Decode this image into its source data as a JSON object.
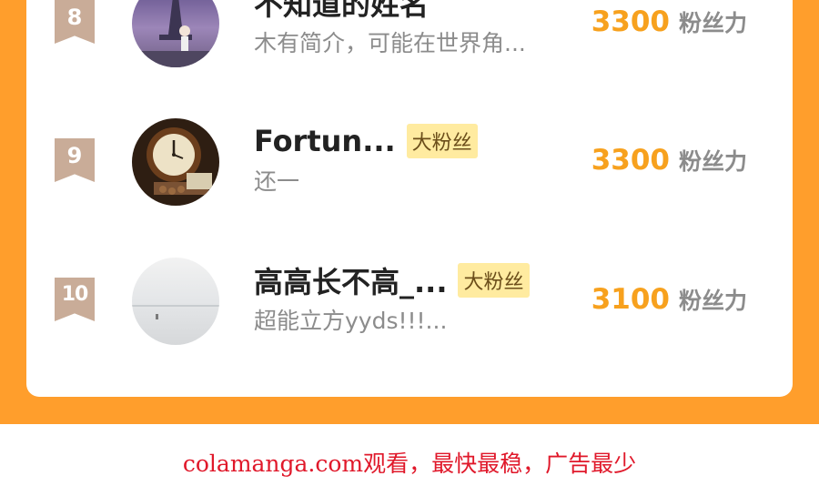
{
  "ranking": [
    {
      "rank": "8",
      "name": "不知道的姓名",
      "badge": "",
      "intro": "木有简介，可能在世界角...",
      "score": "3300",
      "score_unit": "粉丝力"
    },
    {
      "rank": "9",
      "name": "Fortun...",
      "badge": "大粉丝",
      "intro": "还一",
      "score": "3300",
      "score_unit": "粉丝力"
    },
    {
      "rank": "10",
      "name": "高高长不高_...",
      "badge": "大粉丝",
      "intro": "超能立方yyds!!!...",
      "score": "3100",
      "score_unit": "粉丝力"
    }
  ],
  "footer": {
    "watermark_text": "colamanga.com观看，最快最稳，广告最少"
  },
  "colors": {
    "frame": "#FF9E2C",
    "score": "#F7A11E",
    "badge_bg": "#FFEBA0",
    "rank_ribbon": "#C9AC98",
    "watermark": "#E0182A"
  }
}
